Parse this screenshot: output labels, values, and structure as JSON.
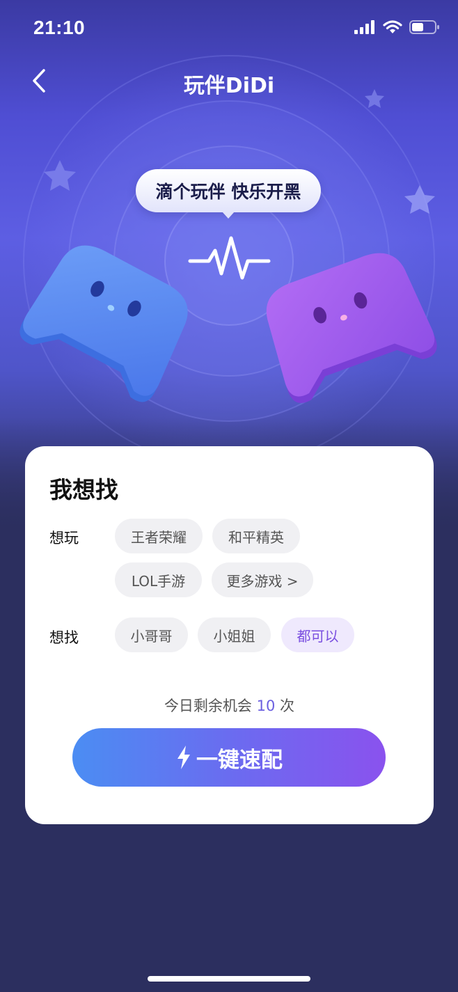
{
  "status_bar": {
    "time": "21:10"
  },
  "nav": {
    "title": "玩伴DiDi"
  },
  "hero": {
    "bubble_text": "滴个玩伴 快乐开黑"
  },
  "card": {
    "title": "我想找",
    "want_play": {
      "label": "想玩",
      "options": [
        "王者荣耀",
        "和平精英",
        "LOL手游",
        "更多游戏 >"
      ]
    },
    "want_find": {
      "label": "想找",
      "options": [
        "小哥哥",
        "小姐姐",
        "都可以"
      ],
      "selected": "都可以"
    },
    "chances": {
      "prefix": "今日剩余机会",
      "count": "10",
      "suffix": "次"
    },
    "match_button": {
      "label": "一键速配",
      "icon": "lightning-icon"
    }
  },
  "colors": {
    "accent_purple": "#7a4fe0",
    "button_gradient_start": "#4b8df3",
    "button_gradient_end": "#8a52ee",
    "background": "#2c2f5f"
  }
}
